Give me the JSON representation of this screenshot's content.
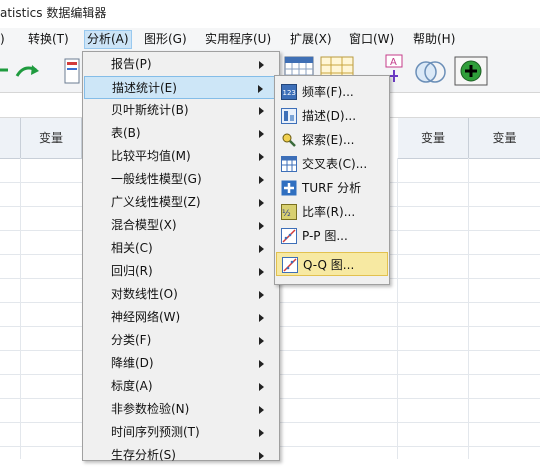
{
  "window": {
    "title": "atistics 数据编辑器"
  },
  "menubar": {
    "items": [
      {
        "label": ")"
      },
      {
        "label": "转换(T)"
      },
      {
        "label": "分析(A)"
      },
      {
        "label": "图形(G)"
      },
      {
        "label": "实用程序(U)"
      },
      {
        "label": "扩展(X)"
      },
      {
        "label": "窗口(W)"
      },
      {
        "label": "帮助(H)"
      }
    ]
  },
  "grid": {
    "column_headers": [
      "变量",
      "变量",
      "变量"
    ]
  },
  "analyze_menu": {
    "items": [
      {
        "label": "报告(P)"
      },
      {
        "label": "描述统计(E)"
      },
      {
        "label": "贝叶斯统计(B)"
      },
      {
        "label": "表(B)"
      },
      {
        "label": "比较平均值(M)"
      },
      {
        "label": "一般线性模型(G)"
      },
      {
        "label": "广义线性模型(Z)"
      },
      {
        "label": "混合模型(X)"
      },
      {
        "label": "相关(C)"
      },
      {
        "label": "回归(R)"
      },
      {
        "label": "对数线性(O)"
      },
      {
        "label": "神经网络(W)"
      },
      {
        "label": "分类(F)"
      },
      {
        "label": "降维(D)"
      },
      {
        "label": "标度(A)"
      },
      {
        "label": "非参数检验(N)"
      },
      {
        "label": "时间序列预测(T)"
      },
      {
        "label": "生存分析(S)"
      }
    ]
  },
  "descriptives_submenu": {
    "items": [
      {
        "label": "频率(F)...",
        "icon": "frequencies-icon"
      },
      {
        "label": "描述(D)...",
        "icon": "descriptives-icon"
      },
      {
        "label": "探索(E)...",
        "icon": "explore-icon"
      },
      {
        "label": "交叉表(C)...",
        "icon": "crosstabs-icon"
      },
      {
        "label": "TURF 分析",
        "icon": "turf-icon"
      },
      {
        "label": "比率(R)...",
        "icon": "ratio-icon"
      },
      {
        "label": "P-P 图...",
        "icon": "pp-plot-icon"
      },
      {
        "label": "Q-Q 图...",
        "icon": "qq-plot-icon"
      }
    ]
  },
  "colors": {
    "highlight_blue": "#cde6f7",
    "highlight_yellow": "#f7e9a2"
  }
}
